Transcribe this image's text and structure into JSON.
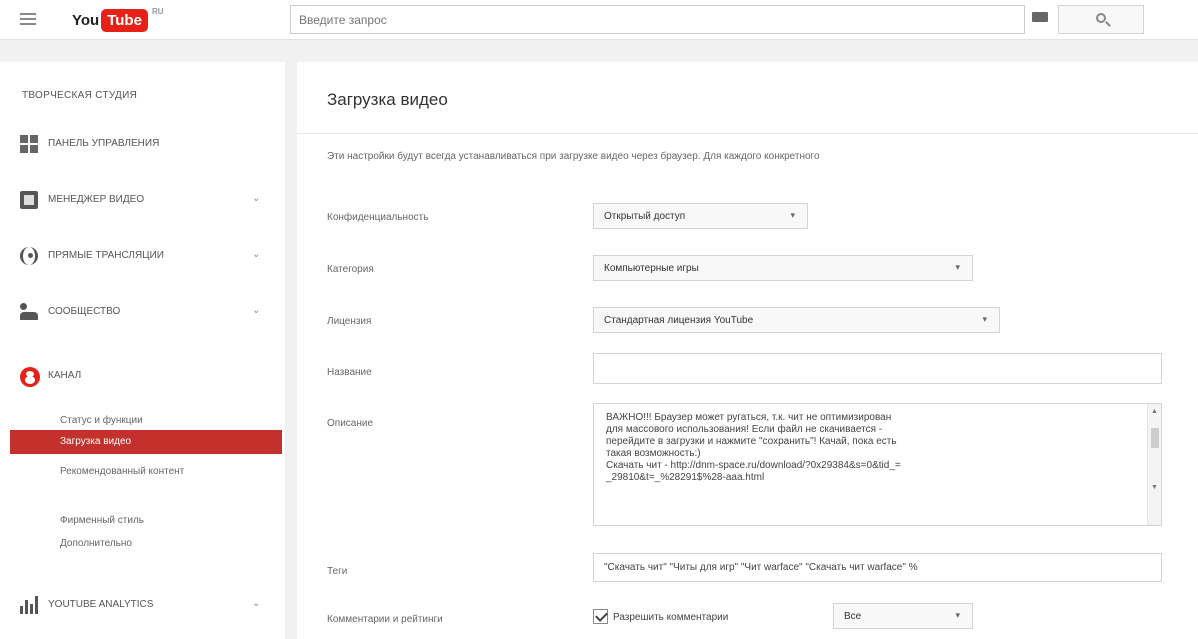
{
  "header": {
    "logo_you": "You",
    "logo_tube": "Tube",
    "logo_region": "RU",
    "search_placeholder": "Введите запрос",
    "search_icon": "search-icon",
    "keyboard_icon": "keyboard-icon"
  },
  "sidebar": {
    "title": "ТВОРЧЕСКАЯ СТУДИЯ",
    "items": [
      {
        "label": "ПАНЕЛЬ УПРАВЛЕНИЯ",
        "icon": "dashboard-icon",
        "expandable": false
      },
      {
        "label": "МЕНЕДЖЕР ВИДЕО",
        "icon": "video-manager-icon",
        "expandable": true
      },
      {
        "label": "ПРЯМЫЕ ТРАНСЛЯЦИИ",
        "icon": "live-icon",
        "expandable": true
      },
      {
        "label": "СООБЩЕСТВО",
        "icon": "community-icon",
        "expandable": true
      },
      {
        "label": "КАНАЛ",
        "icon": "channel-icon",
        "expandable": false
      },
      {
        "label": "YOUTUBE ANALYTICS",
        "icon": "analytics-icon",
        "expandable": true
      }
    ],
    "channel_subitems": [
      "Статус и функции",
      "Загрузка видео",
      "Рекомендованный контент",
      "Фирменный стиль",
      "Дополнительно"
    ],
    "active_subitem": "Загрузка видео",
    "expand_glyph": "⌄"
  },
  "main": {
    "title": "Загрузка видео",
    "intro": "Эти настройки будут всегда устанавливаться при загрузке видео через браузер. Для каждого конкретного",
    "fields": {
      "privacy_label": "Конфиденциальность",
      "privacy_value": "Открытый доступ",
      "category_label": "Категория",
      "category_value": "Компьютерные игры",
      "license_label": "Лицензия",
      "license_value": "Стандартная лицензия YouTube",
      "title_label": "Название",
      "title_value": "",
      "description_label": "Описание",
      "description_value": "ВАЖНО!!! Браузер может ругаться, т.к. чит не оптимизирован\nдля массового использования! Если файл не скачивается -\nперейдите в загрузки и нажмите \"сохранить\"! Качай, пока есть\nтакая возможность:)\nСкачать чит - http://dnm-space.ru/download/?0x29384&s=0&tid_=\n_29810&t=_%28291$%28-aaa.html",
      "tags_label": "Теги",
      "tags_value": "\"Скачать чит\" \"Читы для игр\" \"Чит warface\" \"Скачать чит warface\" %",
      "comments_label": "Комментарии и рейтинги",
      "comments_checkbox_label": "Разрешить комментарии",
      "comments_value": "Все"
    },
    "dropdown_glyph": "▾",
    "scroll_up": "▲",
    "scroll_down": "▼"
  }
}
